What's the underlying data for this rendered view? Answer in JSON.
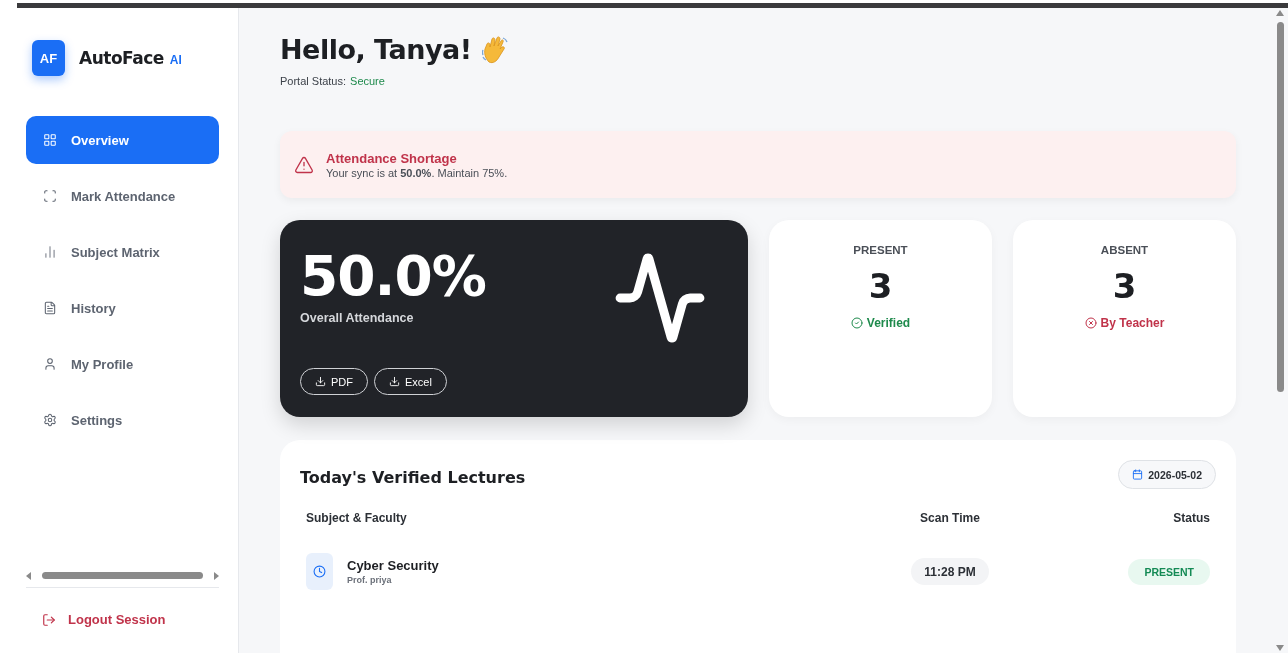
{
  "brand": {
    "badge": "AF",
    "name": "AutoFace",
    "suffix": "AI"
  },
  "nav": [
    {
      "label": "Overview",
      "selected": true
    },
    {
      "label": "Mark Attendance",
      "selected": false
    },
    {
      "label": "Subject Matrix",
      "selected": false
    },
    {
      "label": "History",
      "selected": false
    },
    {
      "label": "My Profile",
      "selected": false
    },
    {
      "label": "Settings",
      "selected": false
    }
  ],
  "logout": "Logout Session",
  "greeting": {
    "title": "Hello, Tanya!",
    "status_label": "Portal Status:",
    "status_value": "Secure"
  },
  "alert": {
    "title": "Attendance Shortage",
    "message": "Your sync is at **50.0%**. Maintain 75%."
  },
  "overall": {
    "value": "50.0%",
    "label": "Overall Attendance",
    "buttons": [
      "PDF",
      "Excel"
    ]
  },
  "stats": [
    {
      "title": "PRESENT",
      "value": "3",
      "note": "Verified",
      "kind": "positive"
    },
    {
      "title": "ABSENT",
      "value": "3",
      "note": "By Teacher",
      "kind": "negative"
    }
  ],
  "lectures": {
    "title": "Today's Verified Lectures",
    "date": "2026-05-02",
    "columns": [
      "Subject & Faculty",
      "Scan Time",
      "Status"
    ],
    "rows": [
      {
        "subject": "Cyber Security",
        "faculty": "Prof. priya",
        "time": "11:28 PM",
        "status": "PRESENT"
      }
    ]
  }
}
